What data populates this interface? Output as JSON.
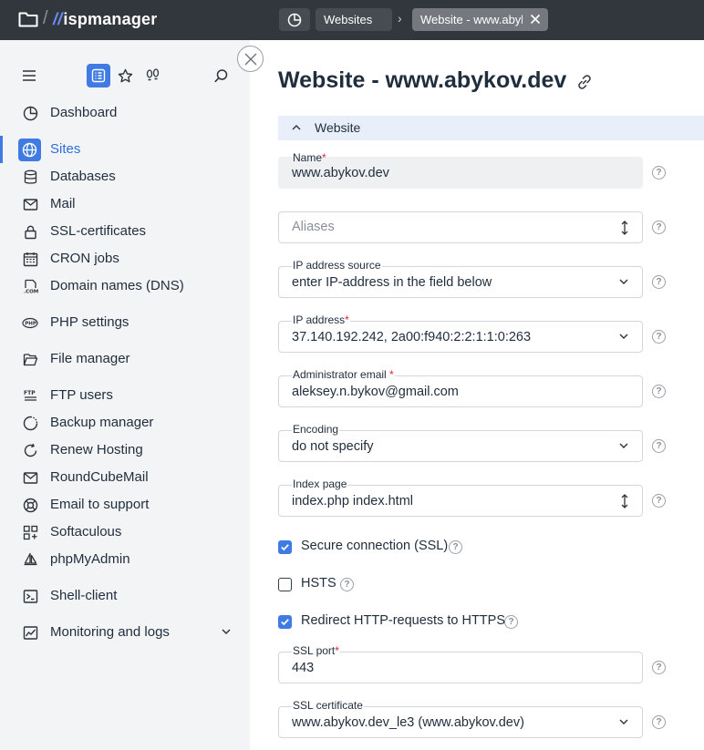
{
  "app": {
    "brand": "ispmanager"
  },
  "breadcrumbs": {
    "websites": "Websites",
    "current": "Website - www.abykov.dev"
  },
  "sidebar": {
    "items": [
      {
        "label": "Dashboard"
      },
      {
        "label": "Sites"
      },
      {
        "label": "Databases"
      },
      {
        "label": "Mail"
      },
      {
        "label": "SSL-certificates"
      },
      {
        "label": "CRON jobs"
      },
      {
        "label": "Domain names (DNS)"
      },
      {
        "label": "PHP settings"
      },
      {
        "label": "File manager"
      },
      {
        "label": "FTP users"
      },
      {
        "label": "Backup manager"
      },
      {
        "label": "Renew Hosting"
      },
      {
        "label": "RoundCubeMail"
      },
      {
        "label": "Email to support"
      },
      {
        "label": "Softaculous"
      },
      {
        "label": "phpMyAdmin"
      },
      {
        "label": "Shell-client"
      },
      {
        "label": "Monitoring and logs"
      }
    ],
    "active_item": "Sites"
  },
  "page": {
    "title": "Website - www.abykov.dev"
  },
  "section": {
    "label": "Website"
  },
  "form": {
    "name": {
      "label": "Name",
      "value": "www.abykov.dev",
      "required": "*"
    },
    "aliases": {
      "placeholder": "Aliases"
    },
    "ip_source": {
      "label": "IP address source",
      "value": "enter IP-address in the field below"
    },
    "ip_address": {
      "label": "IP address",
      "value": "37.140.192.242, 2a00:f940:2:2:1:1:0:263",
      "required": "*"
    },
    "admin_email": {
      "label": "Administrator email",
      "value": "aleksey.n.bykov@gmail.com",
      "required": "*"
    },
    "encoding": {
      "label": "Encoding",
      "value": "do not specify"
    },
    "index_page": {
      "label": "Index page",
      "value": "index.php index.html"
    },
    "ssl": {
      "label": "Secure connection (SSL)",
      "checked": true
    },
    "hsts": {
      "label": "HSTS",
      "checked": false
    },
    "redirect": {
      "label": "Redirect HTTP-requests to HTTPS",
      "checked": true
    },
    "ssl_port": {
      "label": "SSL port",
      "value": "443",
      "required": "*"
    },
    "ssl_cert": {
      "label": "SSL certificate",
      "value": "www.abykov.dev_le3 (www.abykov.dev)"
    }
  },
  "help_symbol": "?",
  "colors": {
    "topbar": "#32373d",
    "accent": "#3f7be3",
    "sidebar_bg": "#f3f4f6",
    "section_bg": "#e9effa",
    "required": "#d9262e"
  }
}
